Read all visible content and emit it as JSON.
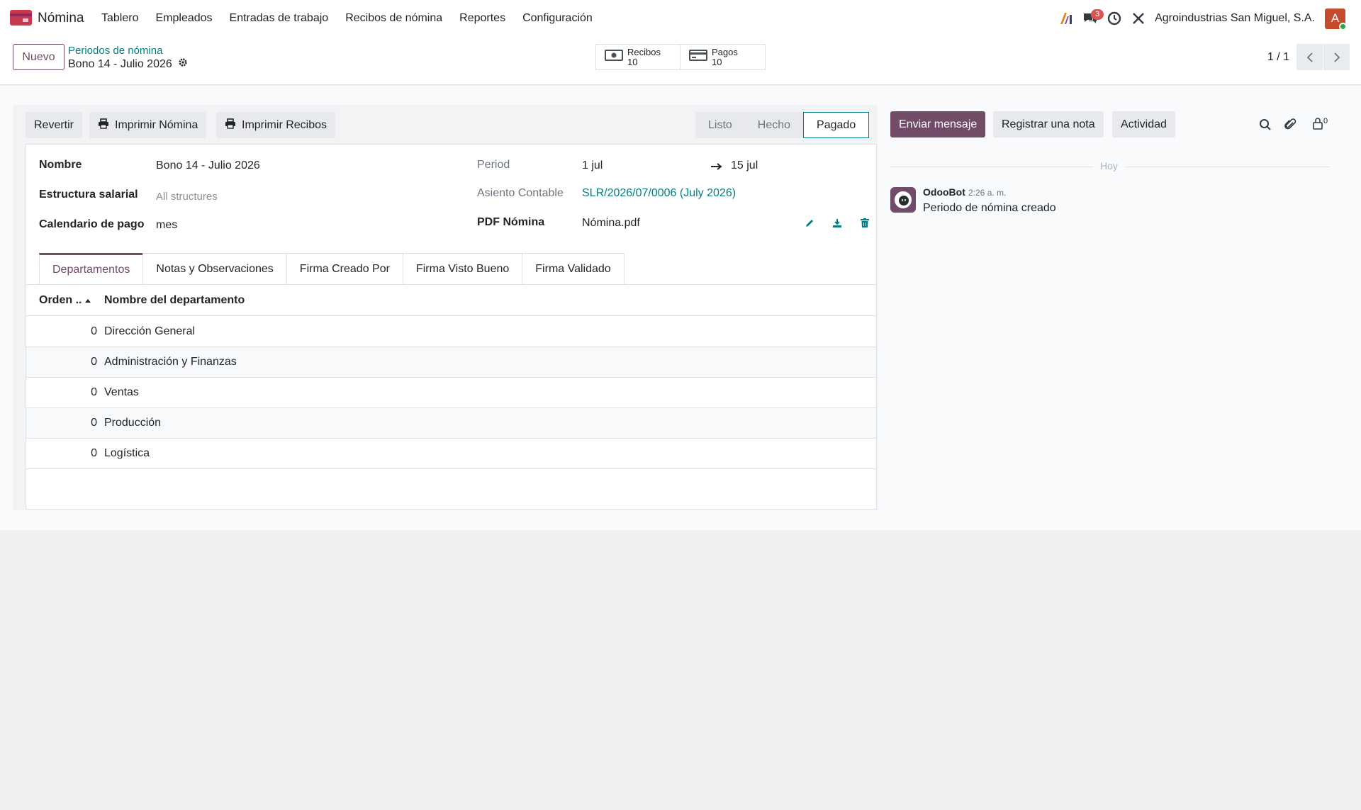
{
  "navbar": {
    "app_name": "Nómina",
    "menu": [
      "Tablero",
      "Empleados",
      "Entradas de trabajo",
      "Recibos de nómina",
      "Reportes",
      "Configuración"
    ],
    "messages_count": "3",
    "company": "Agroindustrias San Miguel, S.A.",
    "avatar_letter": "A"
  },
  "control": {
    "new_label": "Nuevo",
    "breadcrumb_parent": "Periodos de nómina",
    "breadcrumb_current": "Bono 14 - Julio 2026",
    "smart_buttons": [
      {
        "label": "Recibos",
        "count": "10"
      },
      {
        "label": "Pagos",
        "count": "10"
      }
    ],
    "pager": "1 / 1"
  },
  "statusbar": {
    "buttons": [
      "Revertir",
      "Imprimir Nómina",
      "Imprimir Recibos"
    ],
    "stages": [
      "Listo",
      "Hecho",
      "Pagado"
    ],
    "active_stage": "Pagado"
  },
  "form": {
    "name_label": "Nombre",
    "name_value": "Bono 14 - Julio 2026",
    "structure_label": "Estructura salarial",
    "structure_placeholder": "All structures",
    "calendar_label": "Calendario de pago",
    "calendar_value": "mes",
    "period_label": "Period",
    "period_start": "1 jul",
    "period_end": "15 jul",
    "entry_label": "Asiento Contable",
    "entry_value": "SLR/2026/07/0006 (July 2026)",
    "pdf_label": "PDF Nómina",
    "pdf_value": "Nómina.pdf"
  },
  "tabs": [
    "Departamentos",
    "Notas y Observaciones",
    "Firma Creado Por",
    "Firma Visto Bueno",
    "Firma Validado"
  ],
  "table": {
    "headers": [
      "Orden ..",
      "Nombre del departamento"
    ],
    "rows": [
      {
        "order": "0",
        "name": "Dirección General"
      },
      {
        "order": "0",
        "name": "Administración y Finanzas"
      },
      {
        "order": "0",
        "name": "Ventas"
      },
      {
        "order": "0",
        "name": "Producción"
      },
      {
        "order": "0",
        "name": "Logística"
      }
    ]
  },
  "chatter": {
    "send_message": "Enviar mensaje",
    "log_note": "Registrar una nota",
    "activity": "Actividad",
    "followers_count": "0",
    "date_separator": "Hoy",
    "message": {
      "author": "OdooBot",
      "time": "2:26 a. m.",
      "body": "Periodo de nómina creado"
    }
  },
  "colors": {
    "brand": "#714b67",
    "link": "#017e84"
  }
}
